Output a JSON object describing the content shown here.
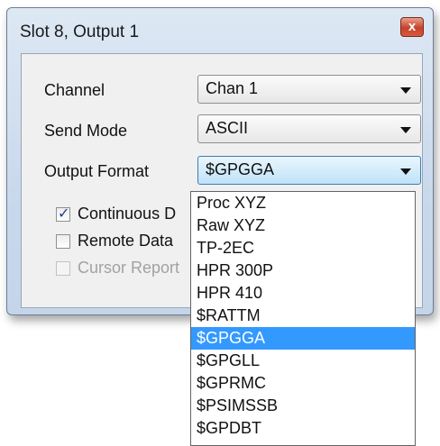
{
  "window": {
    "title": "Slot 8, Output 1",
    "close_glyph": "x"
  },
  "fields": {
    "channel": {
      "label": "Channel",
      "value": "Chan 1"
    },
    "send_mode": {
      "label": "Send Mode",
      "value": "ASCII"
    },
    "output_format": {
      "label": "Output Format",
      "value": "$GPGGA"
    }
  },
  "checkboxes": [
    {
      "label": "Continuous D",
      "checked": true,
      "enabled": true
    },
    {
      "label": "Remote Data",
      "checked": false,
      "enabled": true
    },
    {
      "label": "Cursor Report",
      "checked": false,
      "enabled": false
    }
  ],
  "dropdown": {
    "options": [
      "Proc XYZ",
      "Raw XYZ",
      "TP-2EC",
      "HPR 300P",
      "HPR 410",
      "$RATTM",
      "$GPGGA",
      "$GPGLL",
      "$GPRMC",
      "$PSIMSSB",
      "$GPDBT"
    ],
    "selected": "$GPGGA"
  },
  "colors": {
    "highlight": "#3399ff",
    "close_button": "#c7422a"
  }
}
